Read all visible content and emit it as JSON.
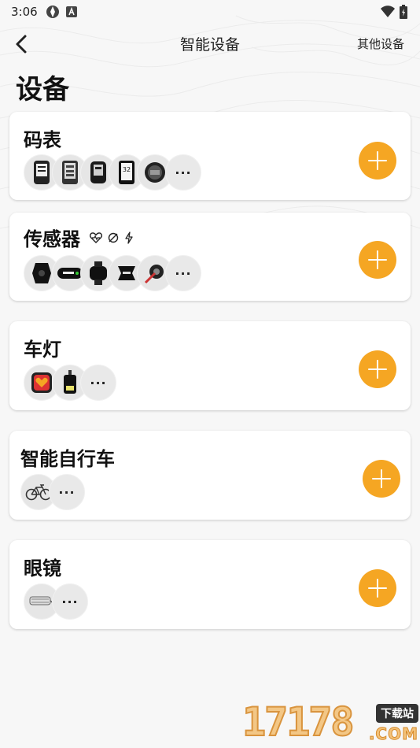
{
  "status_bar": {
    "time": "3:06"
  },
  "nav": {
    "title": "智能设备",
    "other_devices": "其他设备"
  },
  "page_title": "设备",
  "cards": [
    {
      "title": "码表",
      "thumbs": [
        "cycling-computer-icon",
        "cycling-computer-icon",
        "cycling-computer-icon",
        "cycling-computer-icon",
        "cycling-computer-icon"
      ],
      "more": "···"
    },
    {
      "title": "传感器",
      "sensor_icons": [
        "heart-rate-icon",
        "cadence-icon",
        "power-icon"
      ],
      "thumbs": [
        "speed-sensor-icon",
        "heart-rate-strap-icon",
        "watch-sensor-icon",
        "cadence-sensor-icon",
        "power-meter-icon"
      ],
      "more": "···"
    },
    {
      "title": "车灯",
      "thumbs": [
        "tail-light-icon",
        "head-light-icon"
      ],
      "more": "···"
    },
    {
      "title": "智能自行车",
      "thumbs": [
        "bicycle-icon"
      ],
      "more": "···"
    },
    {
      "title": "眼镜",
      "thumbs": [
        "glasses-icon"
      ],
      "more": "···"
    }
  ],
  "watermark": {
    "number": "17178",
    "tag": "下载站",
    "domain": ".COM"
  },
  "colors": {
    "accent": "#f5a623",
    "card_bg": "#ffffff",
    "page_bg": "#f7f7f7"
  }
}
